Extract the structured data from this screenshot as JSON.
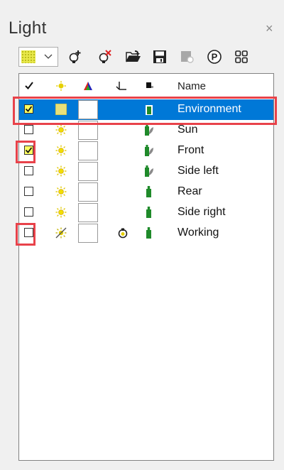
{
  "window": {
    "title": "Light",
    "close_glyph": "×"
  },
  "toolbar": {
    "color_combo_swatch": "#e8e84a",
    "buttons": [
      {
        "icon": "add-light-icon"
      },
      {
        "icon": "delete-light-icon"
      },
      {
        "icon": "open-folder-icon"
      },
      {
        "icon": "save-icon"
      },
      {
        "icon": "disabled-light-icon"
      },
      {
        "icon": "p-circle-icon",
        "glyph": "P"
      },
      {
        "icon": "grid-icon"
      }
    ]
  },
  "list": {
    "columns": [
      {
        "icon": "check-icon"
      },
      {
        "icon": "sun-icon"
      },
      {
        "icon": "color-triangle-icon"
      },
      {
        "icon": "shadow-icon"
      },
      {
        "icon": "lamp-icon"
      },
      {
        "label": "Name"
      }
    ],
    "rows": [
      {
        "name": "Environment",
        "checked": true,
        "selected": true,
        "sun": "swatch",
        "lamp": "plain"
      },
      {
        "name": "Sun",
        "checked": false,
        "selected": false,
        "sun": "sun",
        "lamp": "leaf"
      },
      {
        "name": "Front",
        "checked": true,
        "selected": false,
        "sun": "sun",
        "lamp": "leaf"
      },
      {
        "name": "Side left",
        "checked": false,
        "selected": false,
        "sun": "sun",
        "lamp": "leaf"
      },
      {
        "name": "Rear",
        "checked": false,
        "selected": false,
        "sun": "sun",
        "lamp": "plain"
      },
      {
        "name": "Side right",
        "checked": false,
        "selected": false,
        "sun": "sun",
        "lamp": "plain"
      },
      {
        "name": "Working",
        "checked": false,
        "selected": false,
        "sun": "sun-off",
        "lamp": "plain",
        "shadow": "bulb"
      }
    ]
  },
  "colors": {
    "selection": "#0078d7",
    "highlight_border": "#e8424a",
    "lamp_green": "#1f8a2a"
  }
}
